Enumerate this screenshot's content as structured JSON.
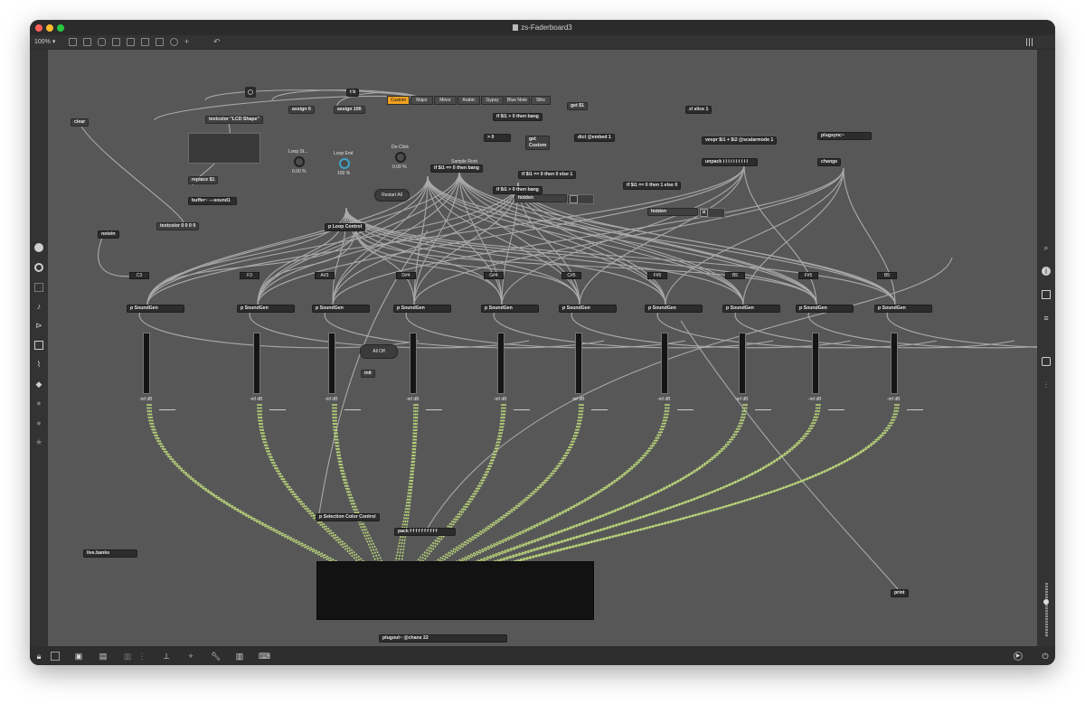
{
  "window": {
    "title": "zs-Faderboard3"
  },
  "toolbar": {
    "zoom": "100%"
  },
  "sidebar_left": [
    "assist-icon",
    "target-icon",
    "clip-icon",
    "music-note-icon",
    "device-icon",
    "image-icon",
    "paperclip-icon",
    "snippet-icon",
    "info-icon",
    "help-icon",
    "star-icon"
  ],
  "sidebar_right": [
    "search-icon",
    "inspector-icon",
    "reference-icon",
    "list-icon",
    "camera-icon",
    "mixer-icon"
  ],
  "scale_tabs": [
    "Custom",
    "Major",
    "Minor",
    "Arabic",
    "Gypsy",
    "Blue Note",
    "5ths"
  ],
  "objects": {
    "clear": "clear",
    "textcolor_lcd": "textcolor \"LCD Shape\"",
    "assign0": "assign 0",
    "assign100": "assign 100",
    "tb": "t b",
    "replace": "replace $1",
    "buffer": "buffer~ ---sound1",
    "textcolor0": "textcolor 0 0 0 0",
    "notein": "notein",
    "ploop": "p Loop Control",
    "if_bang1": "if $i1 > 0 then bang",
    "get1": "get $1",
    "gt0": "> 0",
    "get_custom": "get\nCustom",
    "dict": "dict @embed 1",
    "zlslice": "zl slice 1",
    "vexpr": "vexpr $i1 + $i2 @scalarmode 1",
    "plugsync": "plugsync~",
    "change": "change",
    "unpack": "unpack i i i i i i i i i i",
    "if_eq0": "if $i1 == 0 then bang",
    "if_eq0_else": "if $i1 == 0 then 0 else 1",
    "if_bang2": "if $i1 > 0 then bang",
    "if_eq0_else1": "if $i1 == 0 then 1 else 0",
    "hidden1": "hidden",
    "hidden2": "hidden",
    "init": "init",
    "psel": "p Selection Color Control",
    "pack": "pack f f f f f f f f f f",
    "livebanks": "live.banks",
    "print": "print",
    "plugout": "plugout~ @chans 22"
  },
  "dials": {
    "loop_start": {
      "label": "Loop St...",
      "value": "0.00 %"
    },
    "loop_end": {
      "label": "Loop End",
      "value": "100 %"
    },
    "declick": {
      "label": "De-Click",
      "value": "0.00 %"
    }
  },
  "labels": {
    "sample_root": "Sample Root",
    "restart_all": "Restart All",
    "all_off": "All Off"
  },
  "channels": [
    {
      "note": "C3",
      "gen": "p SoundGen",
      "db": "-inf dB"
    },
    {
      "note": "F3",
      "gen": "p SoundGen",
      "db": "-inf dB"
    },
    {
      "note": "A#3",
      "gen": "p SoundGen",
      "db": "-inf dB"
    },
    {
      "note": "D#4",
      "gen": "p SoundGen",
      "db": "-inf dB"
    },
    {
      "note": "G#4",
      "gen": "p SoundGen",
      "db": "-inf dB"
    },
    {
      "note": "C#5",
      "gen": "p SoundGen",
      "db": "-inf dB"
    },
    {
      "note": "F#5",
      "gen": "p SoundGen",
      "db": "-inf dB"
    },
    {
      "note": "B5",
      "gen": "p SoundGen",
      "db": "-inf dB"
    },
    {
      "note": "F#5",
      "gen": "p SoundGen",
      "db": "-inf dB"
    },
    {
      "note": "B5",
      "gen": "p SoundGen",
      "db": "-inf dB"
    }
  ],
  "colors": {
    "canvas": "#575757",
    "wire": "#a8a8a8",
    "signal_wire": "#b8d27a",
    "selected_tab": "#f0a020",
    "dial_ring": "#3fa3c8"
  }
}
